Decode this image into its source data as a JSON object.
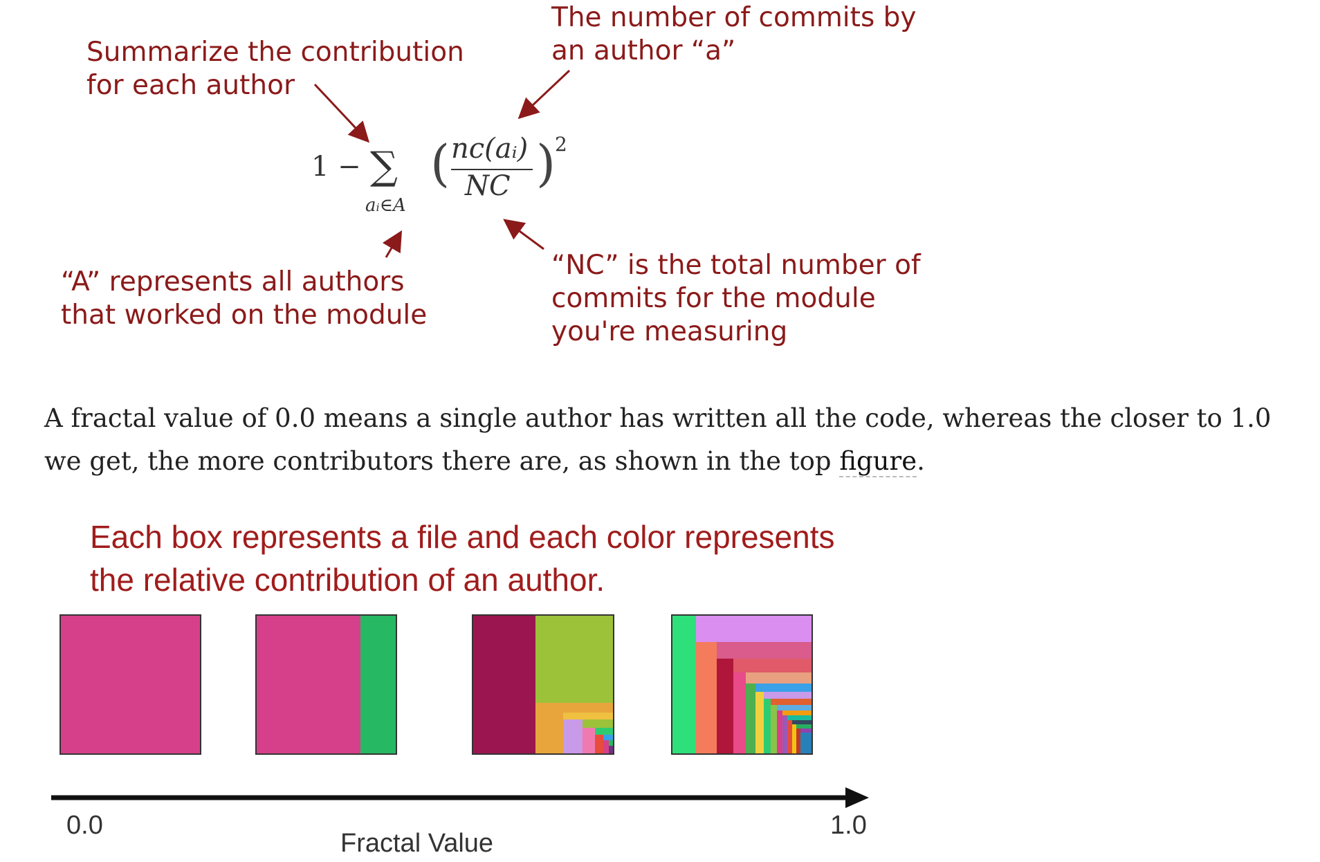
{
  "annotations": {
    "sum_note": [
      "Summarize the contribution",
      "for each author"
    ],
    "commits_note": [
      "The number of commits by",
      "an author “a”"
    ],
    "authors_note": [
      "“A” represents all authors",
      "that worked on the module"
    ],
    "nc_note": [
      "“NC” is the total number of",
      "commits for the module",
      "you're measuring"
    ]
  },
  "formula": {
    "one_minus": "1 −",
    "sigma": "∑",
    "subscript": "aᵢ∈A",
    "numerator": "nc(aᵢ)",
    "denominator": "NC",
    "exponent": "2"
  },
  "paragraph": {
    "text_before_link": "A fractal value of 0.0 means a single author has written all the code, whereas the closer to 1.0 we get, the more contributors there are, as shown in the top ",
    "link_text": "figure",
    "text_after_link": "."
  },
  "caption": [
    "Each box represents a file and each color represents",
    "the relative contribution of an author."
  ],
  "axis": {
    "min_label": "0.0",
    "max_label": "1.0",
    "title": "Fractal Value"
  },
  "colors": {
    "annotation": "#8b1a1a",
    "caption": "#a01c1c",
    "pink": "#d6408a",
    "green": "#27b863",
    "maroon": "#9b1650",
    "olive": "#9cc23a"
  }
}
